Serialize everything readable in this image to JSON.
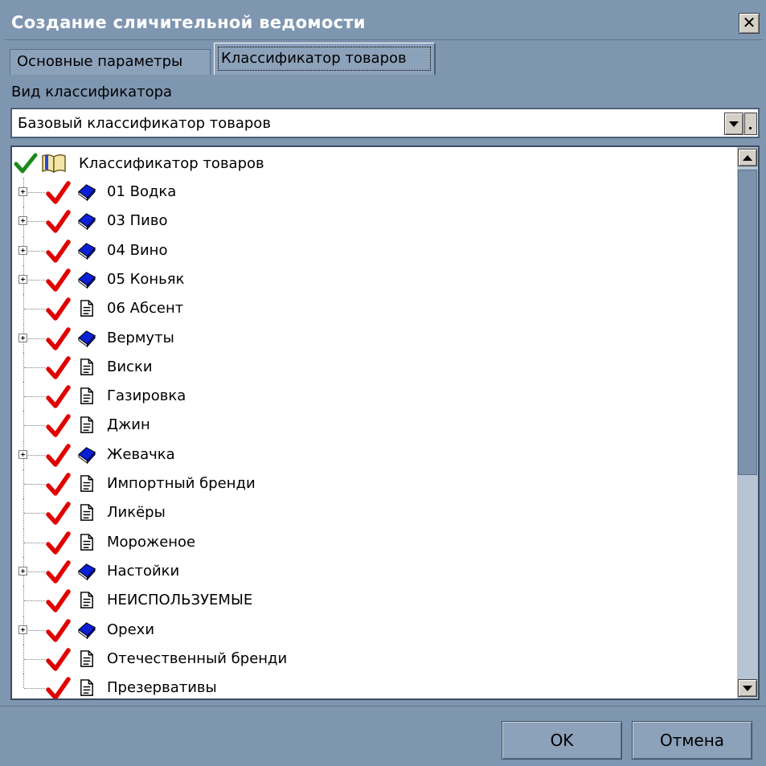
{
  "window": {
    "title": "Создание сличительной ведомости",
    "close_label": "✕"
  },
  "tabs": [
    {
      "label": "Основные параметры"
    },
    {
      "label": "Классификатор товаров"
    }
  ],
  "classifier": {
    "label": "Вид классификатора",
    "selected": "Базовый классификатор товаров"
  },
  "tree": {
    "root": {
      "label": "Классификатор товаров",
      "icon": "open-book-icon",
      "checked": true
    },
    "items": [
      {
        "label": "01 Водка",
        "icon": "book-icon",
        "expandable": true
      },
      {
        "label": "03 Пиво",
        "icon": "book-icon",
        "expandable": true
      },
      {
        "label": "04 Вино",
        "icon": "book-icon",
        "expandable": true
      },
      {
        "label": "05 Коньяк",
        "icon": "book-icon",
        "expandable": true
      },
      {
        "label": "06 Абсент",
        "icon": "document-icon",
        "expandable": false
      },
      {
        "label": "Вермуты",
        "icon": "book-icon",
        "expandable": true
      },
      {
        "label": "Виски",
        "icon": "document-icon",
        "expandable": false
      },
      {
        "label": "Газировка",
        "icon": "document-icon",
        "expandable": false
      },
      {
        "label": "Джин",
        "icon": "document-icon",
        "expandable": false
      },
      {
        "label": "Жевачка",
        "icon": "book-icon",
        "expandable": true
      },
      {
        "label": "Импортный бренди",
        "icon": "document-icon",
        "expandable": false
      },
      {
        "label": "Ликёры",
        "icon": "document-icon",
        "expandable": false
      },
      {
        "label": "Мороженое",
        "icon": "document-icon",
        "expandable": false
      },
      {
        "label": "Настойки",
        "icon": "book-icon",
        "expandable": true
      },
      {
        "label": "НЕИСПОЛЬЗУЕМЫЕ",
        "icon": "document-icon",
        "expandable": false
      },
      {
        "label": "Орехи",
        "icon": "book-icon",
        "expandable": true
      },
      {
        "label": "Отечественный бренди",
        "icon": "document-icon",
        "expandable": false
      },
      {
        "label": "Презервативы",
        "icon": "document-icon",
        "expandable": false
      }
    ]
  },
  "buttons": {
    "ok": "OK",
    "cancel": "Отмена"
  },
  "colors": {
    "window_bg": "#7f96b1",
    "check_red": "#e00000",
    "check_green": "#1a8a1a",
    "book_blue": "#0a1fd6"
  }
}
